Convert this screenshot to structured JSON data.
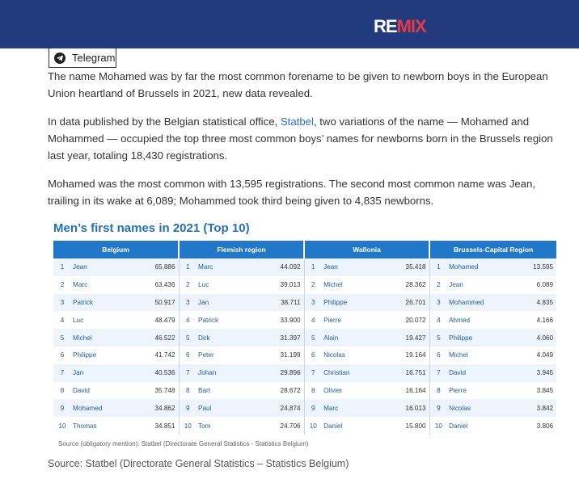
{
  "header": {
    "logo_part1": "RE",
    "logo_part2": "MIX",
    "background_color": "#213b7c",
    "accent_color": "#e63946"
  },
  "share": {
    "icon": "telegram-icon",
    "label": "Telegram"
  },
  "article": {
    "p1": "The name Mohamed was by far the most common forename to be given to newborn boys in the European Union heartland of Brussels in 2021, new data revealed.",
    "p2_before": "In data published by the Belgian statistical office, ",
    "p2_link": "Statbel",
    "p2_after": ", two variations of the name — Mohamed and Mohammed — occupied the top three most common boys’ names for newborns born in the Brussels region last year, totaling 18,430 registrations.",
    "p3": "Mohamed was the most common with 13,595 registrations. The second most common name was Jean, trailing in its wake at 6,089; Mohammed took third being given to 4,835 newborns.",
    "link_color": "#2a6fdb"
  },
  "infographic": {
    "title": "Men’s first names in 2021 (Top 10)",
    "source": "Source (obligatory mention): Statbel (Directorate General Statistics - Statistics Belgium)",
    "header_color": "#2278c8",
    "regions": [
      "Belgium",
      "Flemish region",
      "Wallonia",
      "Brussels-Capital Region"
    ],
    "rows": [
      {
        "rank": "1",
        "cells": [
          [
            "Jean",
            "65.886"
          ],
          [
            "Marc",
            "44.092"
          ],
          [
            "Jean",
            "35.418"
          ],
          [
            "Mohamed",
            "13.595"
          ]
        ]
      },
      {
        "rank": "2",
        "cells": [
          [
            "Marc",
            "63.436"
          ],
          [
            "Luc",
            "39.013"
          ],
          [
            "Michel",
            "28.362"
          ],
          [
            "Jean",
            "6.089"
          ]
        ]
      },
      {
        "rank": "3",
        "cells": [
          [
            "Patrick",
            "50.917"
          ],
          [
            "Jan",
            "38.711"
          ],
          [
            "Philippe",
            "26.701"
          ],
          [
            "Mohammed",
            "4.835"
          ]
        ]
      },
      {
        "rank": "4",
        "cells": [
          [
            "Luc",
            "48.479"
          ],
          [
            "Patrick",
            "33.900"
          ],
          [
            "Pierre",
            "20.072"
          ],
          [
            "Ahmed",
            "4.166"
          ]
        ]
      },
      {
        "rank": "5",
        "cells": [
          [
            "Michel",
            "46.522"
          ],
          [
            "Dirk",
            "31.397"
          ],
          [
            "Alain",
            "19.427"
          ],
          [
            "Philippe",
            "4.060"
          ]
        ]
      },
      {
        "rank": "6",
        "cells": [
          [
            "Philippe",
            "41.742"
          ],
          [
            "Peter",
            "31.199"
          ],
          [
            "Nicolas",
            "19.164"
          ],
          [
            "Michel",
            "4.049"
          ]
        ]
      },
      {
        "rank": "7",
        "cells": [
          [
            "Jan",
            "40.536"
          ],
          [
            "Johan",
            "29.896"
          ],
          [
            "Christian",
            "16.751"
          ],
          [
            "David",
            "3.945"
          ]
        ]
      },
      {
        "rank": "8",
        "cells": [
          [
            "David",
            "35.748"
          ],
          [
            "Bart",
            "28.672"
          ],
          [
            "Olivier",
            "16.164"
          ],
          [
            "Pierre",
            "3.845"
          ]
        ]
      },
      {
        "rank": "9",
        "cells": [
          [
            "Mohamed",
            "34.862"
          ],
          [
            "Paul",
            "24.874"
          ],
          [
            "Marc",
            "16.013"
          ],
          [
            "Nicolas",
            "3.842"
          ]
        ]
      },
      {
        "rank": "10",
        "cells": [
          [
            "Thomas",
            "34.851"
          ],
          [
            "Tom",
            "24.706"
          ],
          [
            "Daniel",
            "15.800"
          ],
          [
            "Daniel",
            "3.806"
          ]
        ]
      }
    ]
  },
  "caption": "Source: Statbel (Directorate General Statistics – Statistics Belgium)"
}
